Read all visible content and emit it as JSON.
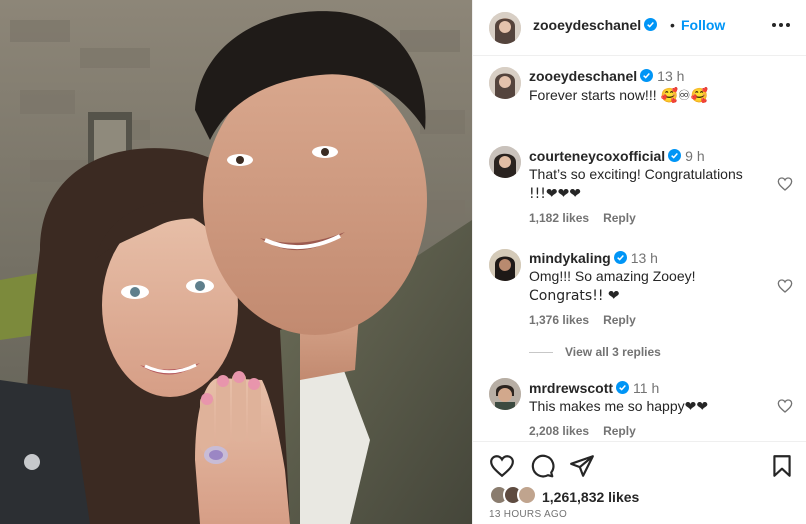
{
  "post": {
    "author": "zooeydeschanel",
    "follow_label": "Follow",
    "dot": "•",
    "caption": {
      "username": "zooeydeschanel",
      "time": "13 h",
      "text": "Forever starts now!!! 🥰♾🥰"
    },
    "likes": "1,261,832 likes",
    "posted_ago": "13 HOURS AGO"
  },
  "comments": [
    {
      "username": "courteneycoxofficial",
      "time": "9 h",
      "text_line1": "That’s so exciting! Congratulations",
      "text_line2": "!!!❤❤❤",
      "likes": "1,182 likes",
      "reply": "Reply"
    },
    {
      "username": "mindykaling",
      "time": "13 h",
      "text_line1": "Omg!!! So amazing Zooey!",
      "text_line2": "Congrats!! ❤",
      "likes": "1,376 likes",
      "reply": "Reply"
    },
    {
      "username": "mrdrewscott",
      "time": "11 h",
      "text_line1": "This makes me so happy❤❤",
      "likes": "2,208 likes",
      "reply": "Reply"
    }
  ],
  "view_replies": "View all 3 replies",
  "icons": {
    "heart": "heart-icon",
    "comment": "comment-icon",
    "share": "share-icon",
    "save": "bookmark-icon",
    "more": "more-options-icon",
    "verified": "verified-badge-icon"
  },
  "colors": {
    "accent": "#0095f6",
    "verified": "#0095f6",
    "secondary_text": "#737373",
    "heart_emoji": "#e0245e"
  }
}
